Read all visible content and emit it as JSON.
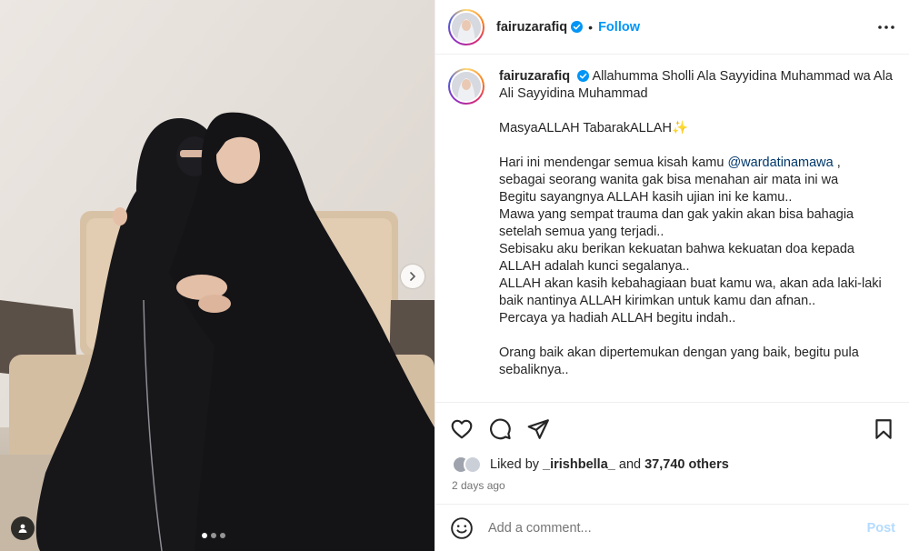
{
  "post": {
    "media": {
      "icons": {
        "next": "chevron-right-icon",
        "tag": "user-tag-icon"
      },
      "carousel_dots": 3,
      "active_dot": 0
    },
    "header": {
      "username": "fairuzarafiq",
      "separator": "•",
      "follow_label": "Follow",
      "icons": {
        "verified": "verified-badge-icon",
        "more": "more-options-icon"
      }
    },
    "caption": {
      "username": "fairuzarafiq",
      "lines": [
        "Allahumma Sholli Ala Sayyidina Muhammad wa Ala Ali Sayyidina Muhammad",
        "",
        "MasyaALLAH TabarakALLAH✨",
        "",
        "Hari ini mendengar semua kisah kamu",
        "sebagai seorang wanita gak bisa menahan air mata ini wa",
        "Begitu sayangnya ALLAH kasih ujian ini ke kamu..",
        "Mawa yang sempat trauma dan gak yakin akan bisa bahagia setelah semua yang terjadi..",
        "Sebisaku aku berikan kekuatan bahwa kekuatan doa kepada ALLAH adalah kunci segalanya..",
        "ALLAH akan kasih kebahagiaan buat kamu wa, akan ada laki-laki baik nantinya ALLAH kirimkan untuk kamu dan afnan..",
        "Percaya ya hadiah ALLAH begitu indah..",
        "",
        "Orang baik akan dipertemukan dengan yang baik, begitu pula sebaliknya.."
      ],
      "mention": "@wardatinamawa",
      "mention_suffix": " ,"
    },
    "actions": {
      "icons": [
        "heart-icon",
        "comment-icon",
        "share-icon",
        "bookmark-icon"
      ]
    },
    "likes": {
      "prefix": "Liked by",
      "user": "_irishbella_",
      "conjunction": "and",
      "others": "37,740 others"
    },
    "time_ago": "2 days ago",
    "comment": {
      "placeholder": "Add a comment...",
      "post_label": "Post",
      "icons": {
        "emoji": "emoji-icon"
      }
    },
    "colors": {
      "link_blue": "#0095f6",
      "mention": "#00376b",
      "post_disabled": "#b3dbff",
      "muted": "#737373",
      "text": "#262626"
    }
  }
}
